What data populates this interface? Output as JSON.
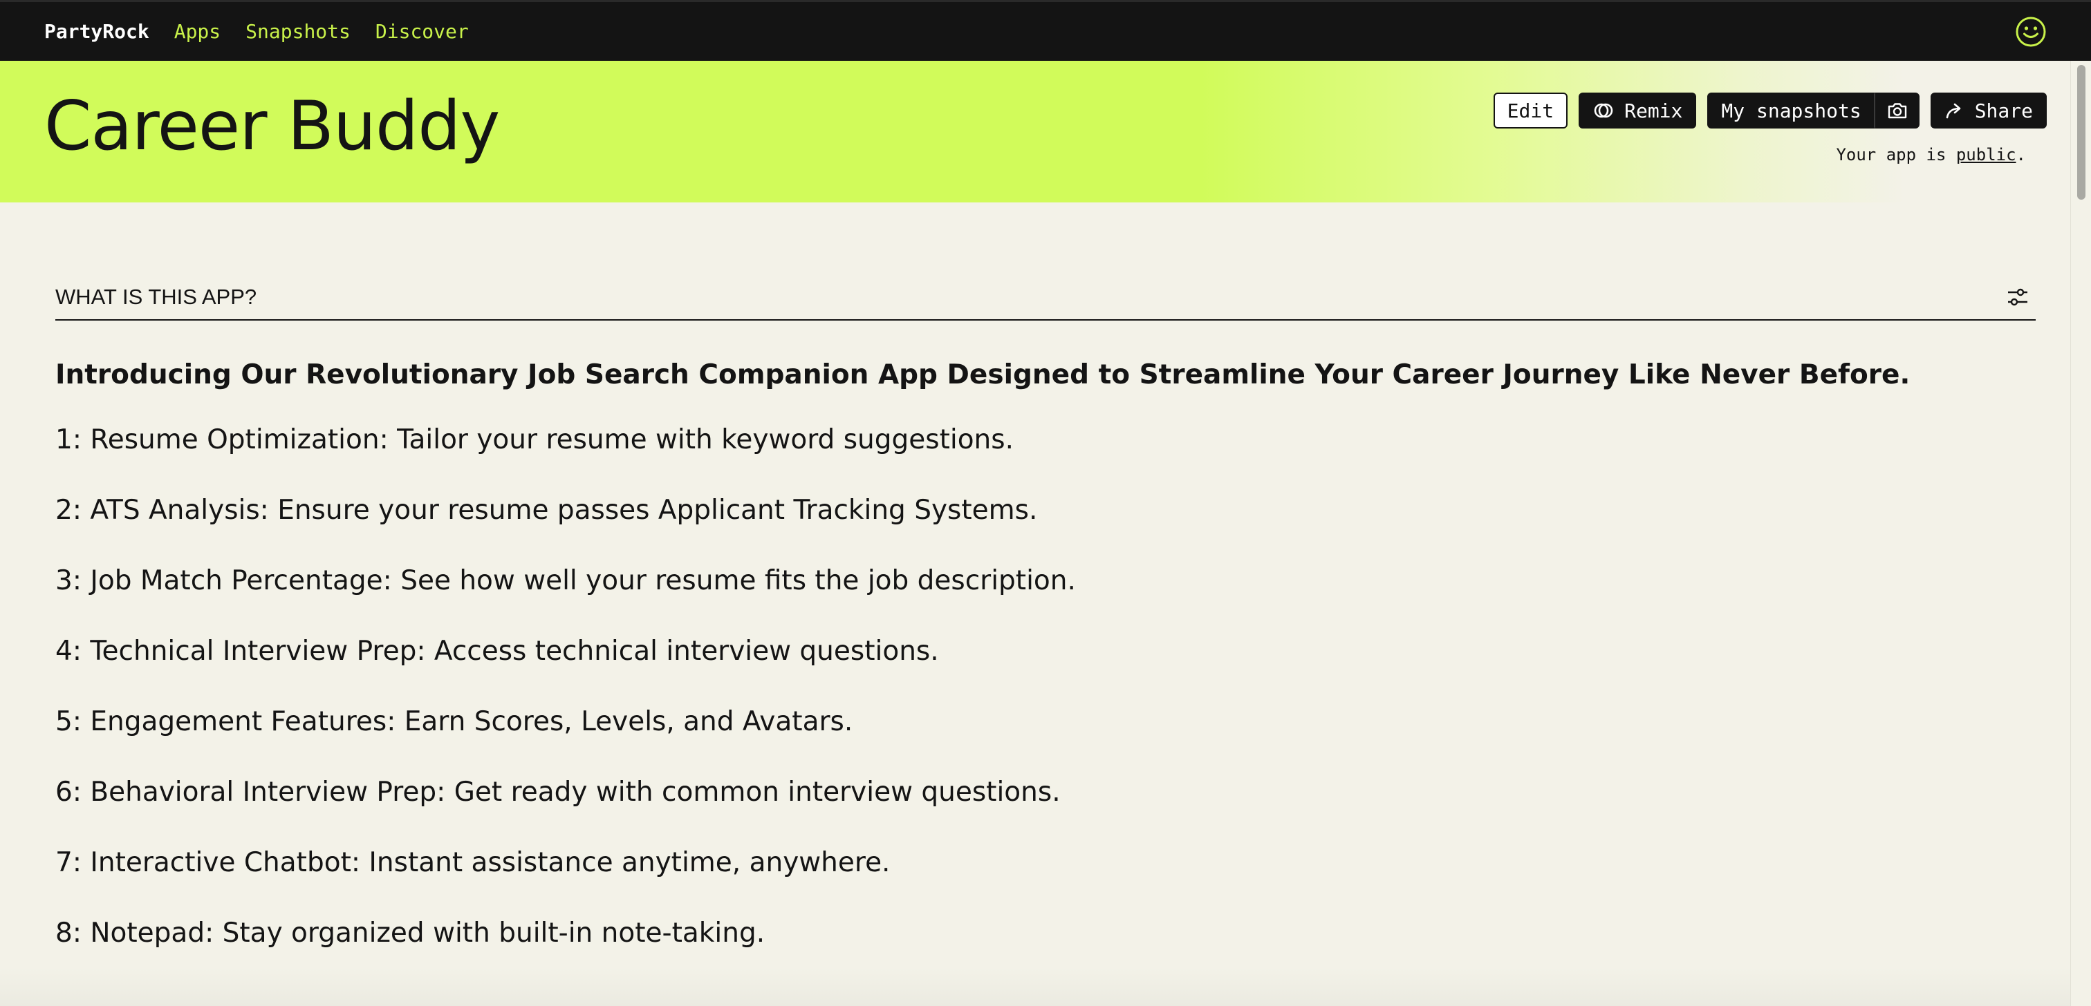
{
  "nav": {
    "brand": "PartyRock",
    "links": [
      "Apps",
      "Snapshots",
      "Discover"
    ],
    "avatar_icon": "smiley-face-icon"
  },
  "header": {
    "title": "Career Buddy",
    "buttons": {
      "edit": "Edit",
      "remix": "Remix",
      "my_snapshots": "My snapshots",
      "share": "Share"
    },
    "visibility_prefix": "Your app is ",
    "visibility_link": "public",
    "visibility_suffix": "."
  },
  "widget": {
    "title": "WHAT IS THIS APP?",
    "intro": "Introducing Our Revolutionary Job Search Companion App Designed to Streamline Your Career Journey Like Never Before.",
    "features": [
      "1: Resume Optimization: Tailor your resume with keyword suggestions.",
      "2: ATS Analysis: Ensure your resume passes Applicant Tracking Systems.",
      "3: Job Match Percentage: See how well your resume fits the job description.",
      "4: Technical Interview Prep: Access technical interview questions.",
      "5: Engagement Features: Earn Scores, Levels, and Avatars.",
      "6: Behavioral Interview Prep: Get ready with common interview questions.",
      "7: Interactive Chatbot: Instant assistance anytime, anywhere.",
      "8: Notepad: Stay organized with built-in note-taking."
    ]
  },
  "colors": {
    "nav_bg": "#141414",
    "accent_lime": "#d1fb5a",
    "nav_link": "#c9f24a",
    "page_bg": "#f3f2e8"
  }
}
